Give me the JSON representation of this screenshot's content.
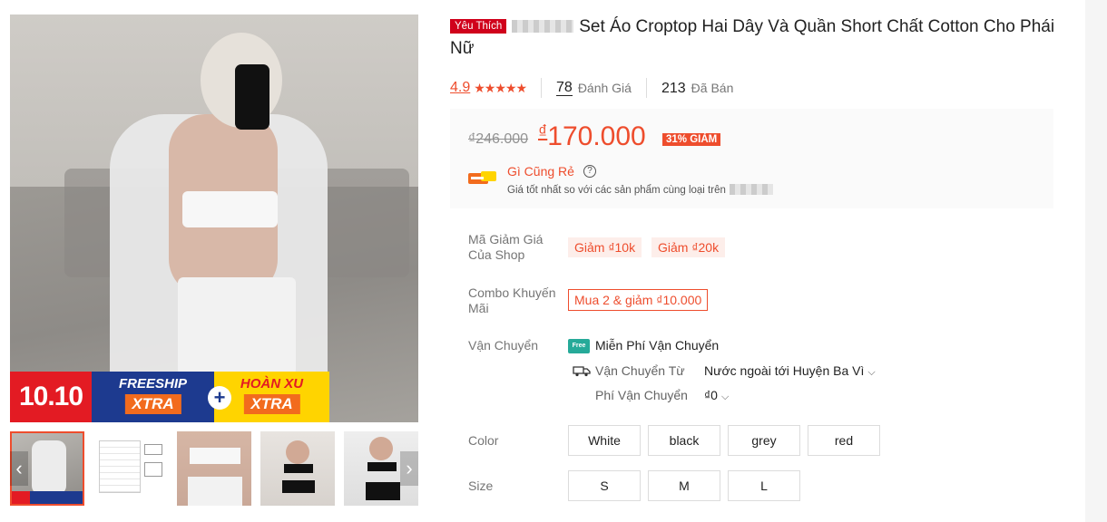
{
  "gallery": {
    "promo_1010": "10.10",
    "promo_freeship": "FREESHIP",
    "promo_xtra_1": "XTRA",
    "promo_plus": "+",
    "promo_hoan_xu": "HOÀN XU",
    "promo_xtra_2": "XTRA",
    "prev_arrow": "‹",
    "next_arrow": "›"
  },
  "product": {
    "badge": "Yêu Thích",
    "title": "Set Áo Croptop Hai Dây Và Quần Short Chất Cotton Cho Phái Nữ",
    "rating": "4.9",
    "stars": "★★★★★",
    "review_count": "78",
    "review_label": "Đánh Giá",
    "sold_count": "213",
    "sold_label": "Đã Bán"
  },
  "price": {
    "old": "₫246.000",
    "currency": "₫",
    "current": "170.000",
    "discount": "31% GIẢM",
    "cheap_title": "Gì Cũng Rẻ",
    "cheap_help": "?",
    "cheap_sub": "Giá tốt nhất so với các sản phẩm cùng loại trên"
  },
  "vouchers": {
    "label": "Mã Giảm Giá Của Shop",
    "items": [
      "Giảm ₫10k",
      "Giảm ₫20k"
    ]
  },
  "combo": {
    "label": "Combo Khuyến Mãi",
    "value": "Mua 2 & giảm ₫10.000"
  },
  "shipping": {
    "label": "Vận Chuyển",
    "free_icon": "Free",
    "free_text": "Miễn Phí Vận Chuyển",
    "from_label": "Vận Chuyển Từ",
    "from_value": "Nước ngoài tới Huyện Ba Vì",
    "fee_label": "Phí Vận Chuyển",
    "fee_value": "₫0",
    "chevron": "⌵"
  },
  "color": {
    "label": "Color",
    "options": [
      "White",
      "black",
      "grey",
      "red"
    ]
  },
  "size": {
    "label": "Size",
    "options": [
      "S",
      "M",
      "L"
    ]
  },
  "colors": {
    "accent": "#ee4d2d",
    "badge_red": "#d0011b",
    "free_ship_teal": "#26aa99"
  }
}
